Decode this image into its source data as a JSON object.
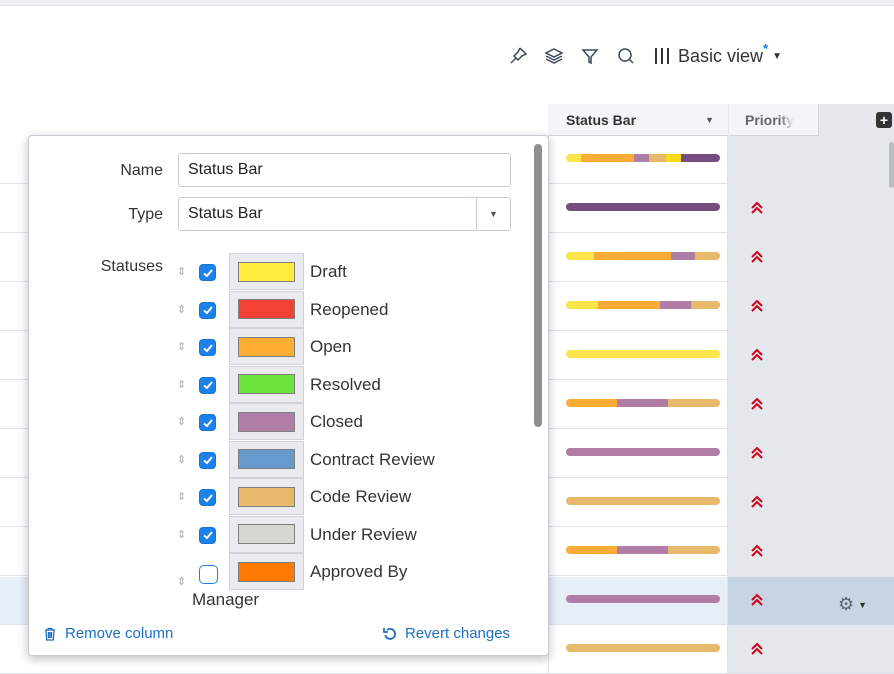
{
  "toolbar": {
    "icons": [
      "pin-icon",
      "layers-icon",
      "filter-icon",
      "search-icon",
      "columns-icon"
    ],
    "view_label": "Basic view",
    "view_modified_marker": "*"
  },
  "table": {
    "columns": [
      {
        "label": "Status Bar"
      },
      {
        "label": "Priority"
      }
    ],
    "rows": [
      {
        "segments": [
          [
            "#fbe54a",
            0.1
          ],
          [
            "#fbac37",
            0.34
          ],
          [
            "#b07da6",
            0.1
          ],
          [
            "#e8b96a",
            0.11
          ],
          [
            "#f9d914",
            0.1
          ],
          [
            "#774d80",
            0.25
          ]
        ],
        "priority": ""
      },
      {
        "segments": [
          [
            "#774d80",
            1.0
          ]
        ],
        "priority": "highest"
      },
      {
        "segments": [
          [
            "#fbe54a",
            0.18
          ],
          [
            "#fbac37",
            0.5
          ],
          [
            "#b07da6",
            0.16
          ],
          [
            "#e8b96a",
            0.16
          ]
        ],
        "priority": "highest"
      },
      {
        "segments": [
          [
            "#fbe54a",
            0.21
          ],
          [
            "#fbac37",
            0.4
          ],
          [
            "#b07da6",
            0.2
          ],
          [
            "#e8b96a",
            0.19
          ]
        ],
        "priority": "highest"
      },
      {
        "segments": [
          [
            "#fbe54a",
            1.0
          ]
        ],
        "priority": "highest"
      },
      {
        "segments": [
          [
            "#fbac37",
            0.33
          ],
          [
            "#b07da6",
            0.33
          ],
          [
            "#e8b96a",
            0.34
          ]
        ],
        "priority": "highest"
      },
      {
        "segments": [
          [
            "#b07da6",
            1.0
          ]
        ],
        "priority": "highest"
      },
      {
        "segments": [
          [
            "#e8b96a",
            1.0
          ]
        ],
        "priority": "highest"
      },
      {
        "segments": [
          [
            "#fbac37",
            0.33
          ],
          [
            "#b07da6",
            0.33
          ],
          [
            "#e8b96a",
            0.34
          ]
        ],
        "priority": "highest"
      },
      {
        "segments": [
          [
            "#b07da6",
            1.0
          ]
        ],
        "priority": "highest",
        "selected": true
      },
      {
        "segments": [
          [
            "#e8b96a",
            1.0
          ]
        ],
        "priority": "highest"
      }
    ]
  },
  "popup": {
    "name_label": "Name",
    "name_value": "Status Bar",
    "type_label": "Type",
    "type_value": "Status Bar",
    "statuses_label": "Statuses",
    "statuses": [
      {
        "name": "Draft",
        "color": "#ffeb3b",
        "checked": true
      },
      {
        "name": "Reopened",
        "color": "#f44336",
        "checked": true
      },
      {
        "name": "Open",
        "color": "#ffad33",
        "checked": true
      },
      {
        "name": "Resolved",
        "color": "#6be33a",
        "checked": true
      },
      {
        "name": "Closed",
        "color": "#b07da6",
        "checked": true
      },
      {
        "name": "Contract Review",
        "color": "#6699cc",
        "checked": true
      },
      {
        "name": "Code Review",
        "color": "#e8b96a",
        "checked": true
      },
      {
        "name": "Under Review",
        "color": "#d3d9d0",
        "checked": true
      },
      {
        "name": "Approved By",
        "name_cont": "Manager",
        "color": "#ff7a00",
        "checked": false
      }
    ],
    "remove_label": "Remove column",
    "revert_label": "Revert changes"
  },
  "colors": {
    "accent": "#1a82ea",
    "priority_highest": "#d0021b"
  }
}
